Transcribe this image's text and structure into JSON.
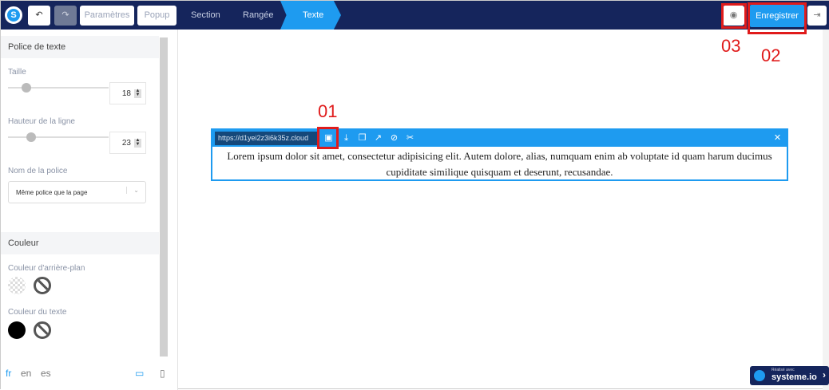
{
  "topbar": {
    "undo_icon": "undo-icon",
    "redo_icon": "redo-icon",
    "parametres": "Paramètres",
    "popup": "Popup",
    "breadcrumbs": [
      "Section",
      "Rangée",
      "Texte"
    ],
    "save": "Enregistrer",
    "preview_icon": "eye-icon",
    "exit_icon": "exit-icon"
  },
  "callouts": {
    "c1": "01",
    "c2": "02",
    "c3": "03"
  },
  "sidebar": {
    "font_section": "Police de texte",
    "size_label": "Taille",
    "size_value": "18",
    "size_fraction": 0.15,
    "line_label": "Hauteur de la ligne",
    "line_value": "23",
    "line_fraction": 0.2,
    "font_name_label": "Nom de la police",
    "font_name_value": "Même police que la page",
    "color_section": "Couleur",
    "bg_label": "Couleur d'arrière-plan",
    "text_color_label": "Couleur du texte",
    "text_color": "#000000",
    "langs": [
      "fr",
      "en",
      "es"
    ]
  },
  "editor": {
    "url": "https://d1yei2z3i6k35z.cloud",
    "body": "Lorem ipsum dolor sit amet, consectetur adipisicing elit. Autem dolore, alias, numquam enim ab voluptate id quam harum ducimus cupiditate similique quisquam et deserunt, recusandae."
  },
  "badge": {
    "small": "Réalisé avec",
    "brand": "systeme.io"
  },
  "colors": {
    "navy": "#15255c",
    "accent": "#1e9bf0",
    "callout": "#e01b1b"
  }
}
